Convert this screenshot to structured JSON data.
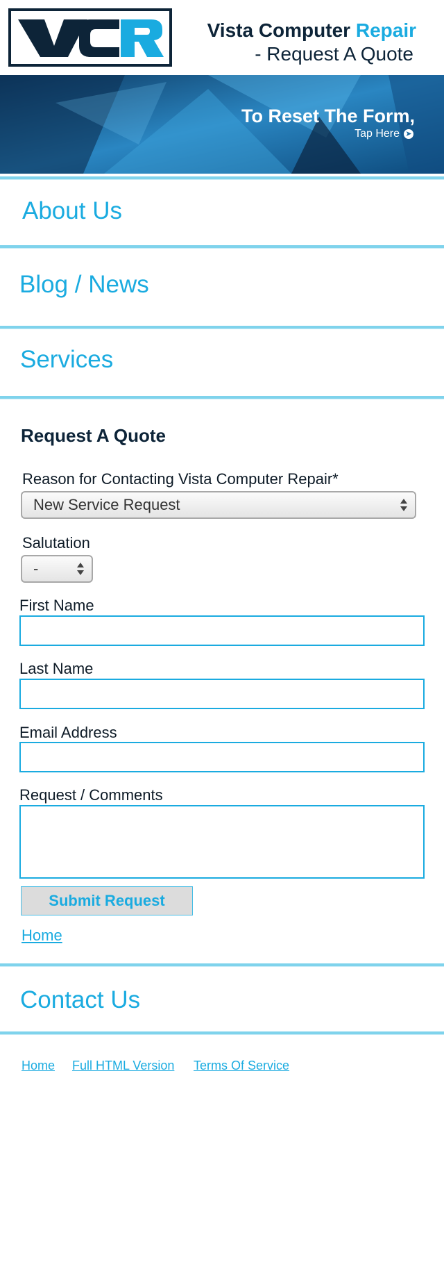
{
  "header": {
    "logo_text": "VCR",
    "title_main": "Vista Computer ",
    "title_accent": "Repair",
    "subtitle": "- Request A Quote"
  },
  "banner": {
    "reset_title": "To Reset The Form,",
    "reset_link": "Tap Here"
  },
  "nav": {
    "about": "About Us",
    "blog": "Blog / News",
    "services": "Services",
    "contact": "Contact Us"
  },
  "form": {
    "heading": "Request A Quote",
    "reason_label": "Reason for Contacting Vista Computer Repair*",
    "reason_value": "New Service Request",
    "salutation_label": "Salutation",
    "salutation_value": "-",
    "first_name_label": "First Name",
    "first_name_value": "",
    "last_name_label": "Last Name",
    "last_name_value": "",
    "email_label": "Email Address",
    "email_value": "",
    "comments_label": "Request / Comments",
    "comments_value": "",
    "submit_label": "Submit Request",
    "home_link": "Home"
  },
  "footer": {
    "home": "Home",
    "full_html": "Full HTML Version",
    "terms": "Terms Of Service"
  },
  "colors": {
    "accent": "#1aabe0",
    "navy": "#0d2438",
    "divider": "#7fd3ec"
  }
}
